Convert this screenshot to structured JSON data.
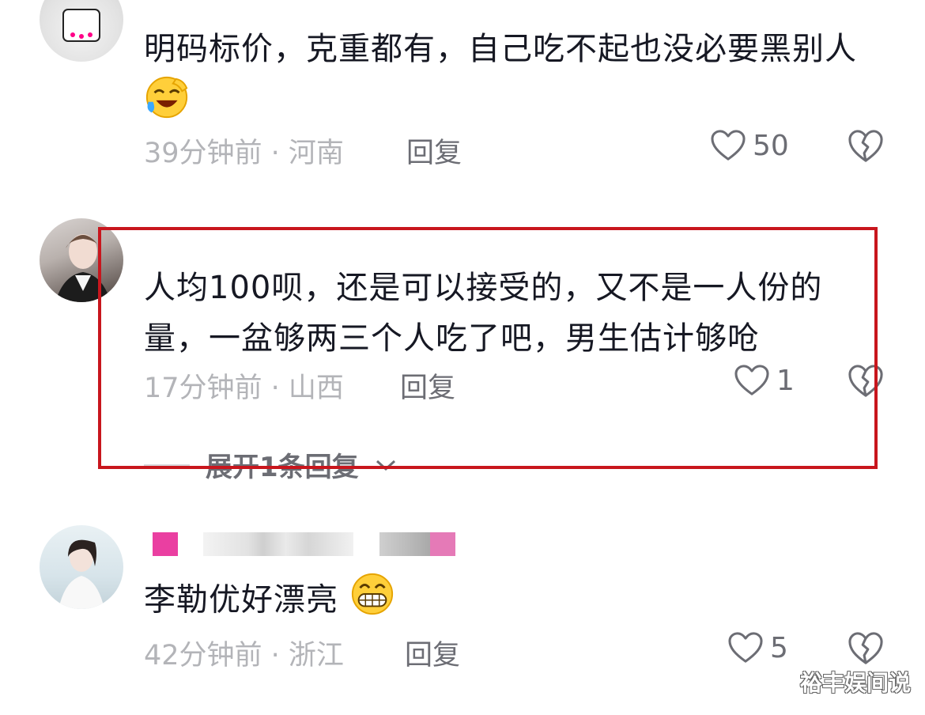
{
  "comments": [
    {
      "text": "明码标价，克重都有，自己吃不起也没必要黑别人",
      "emoji": "laughing-tears-emoji",
      "time": "39分钟前 · 河南",
      "reply_label": "回复",
      "likes": "50"
    },
    {
      "text": "人均100呗，还是可以接受的，又不是一人份的量，一盆够两三个人吃了吧，男生估计够呛",
      "time": "17分钟前 · 山西",
      "reply_label": "回复",
      "likes": "1",
      "expand_label": "展开1条回复"
    },
    {
      "text": "李勒优好漂亮",
      "emoji": "grinning-emoji",
      "time": "42分钟前 · 浙江",
      "reply_label": "回复",
      "likes": "5"
    }
  ],
  "watermark": "裕丰娱间说",
  "colors": {
    "highlight_border": "#c8161d",
    "meta_text": "#b3b4b8",
    "icon": "#6c6d74"
  }
}
